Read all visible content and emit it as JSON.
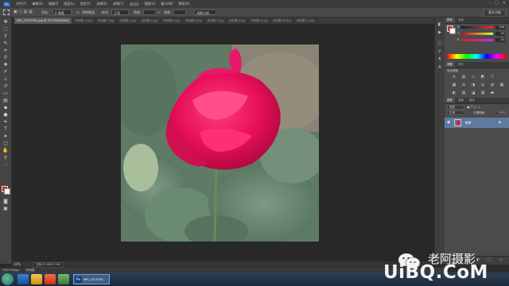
{
  "app": {
    "logo": "Ps"
  },
  "menubar": {
    "items": [
      "文件(F)",
      "编辑(E)",
      "图像(I)",
      "图层(L)",
      "类型(Y)",
      "选择(S)",
      "滤镜(T)",
      "3D(D)",
      "视图(V)",
      "窗口(W)",
      "帮助(H)"
    ]
  },
  "window_controls": {
    "minimize": "–",
    "maximize": "□",
    "close": "✕"
  },
  "options": {
    "feather_label": "羽化:",
    "feather_value": "0 像素",
    "antialias_label": "消除锯齿",
    "style_label": "样式:",
    "style_value": "正常",
    "width_label": "宽度:",
    "height_label": "高度:",
    "refine_label": "调整边缘...",
    "workspace": "基本功能"
  },
  "tabs": [
    {
      "label": "IMG_20170302.jpg @ 33.3%(RGB/8#)",
      "active": true
    },
    {
      "label": "未标题-1.psd",
      "active": false
    },
    {
      "label": "未标题-2.jpg",
      "active": false
    },
    {
      "label": "未标题-3.jpg",
      "active": false
    },
    {
      "label": "未标题-4.jpg",
      "active": false
    },
    {
      "label": "未标题-5.jpg",
      "active": false
    },
    {
      "label": "未标题-6.jpg",
      "active": false
    },
    {
      "label": "未标题-7.jpg",
      "active": false
    },
    {
      "label": "未标题-8.jpg",
      "active": false
    },
    {
      "label": "未标题-9.jpg",
      "active": false
    },
    {
      "label": "未标题-10.jpg",
      "active": false
    },
    {
      "label": "未标题-11.jpg",
      "active": false
    }
  ],
  "color_panel": {
    "tabs": [
      "颜色",
      "色板"
    ],
    "sliders": [
      {
        "label": "R",
        "value": "208"
      },
      {
        "label": "G",
        "value": "40"
      },
      {
        "label": "B",
        "value": "43"
      }
    ]
  },
  "adjustments_panel": {
    "tabs": [
      "调整",
      "样式"
    ],
    "hint": "添加调整"
  },
  "layers_panel": {
    "tabs": [
      "图层",
      "通道",
      "路径"
    ],
    "kind_label": "类型",
    "blend_mode": "正常",
    "opacity_label": "不透明度:",
    "opacity_value": "100%",
    "lock_label": "锁定:",
    "fill_label": "填充:",
    "fill_value": "100%",
    "layer_name": "背景"
  },
  "status": {
    "zoom": "33%",
    "docinfo": "文档:23.9M/23.9M"
  },
  "minibridge": {
    "tabs": [
      "Mini Bridge",
      "时间轴"
    ]
  },
  "taskbar": {
    "ps_label": "IMG_2017030..."
  },
  "colors": {
    "accent": "#5e7aa0",
    "foreground": "#d62a2a",
    "background": "#f5f5f5"
  },
  "watermark": {
    "name": "老阿摄影",
    "site": "UiBQ.CoM"
  }
}
